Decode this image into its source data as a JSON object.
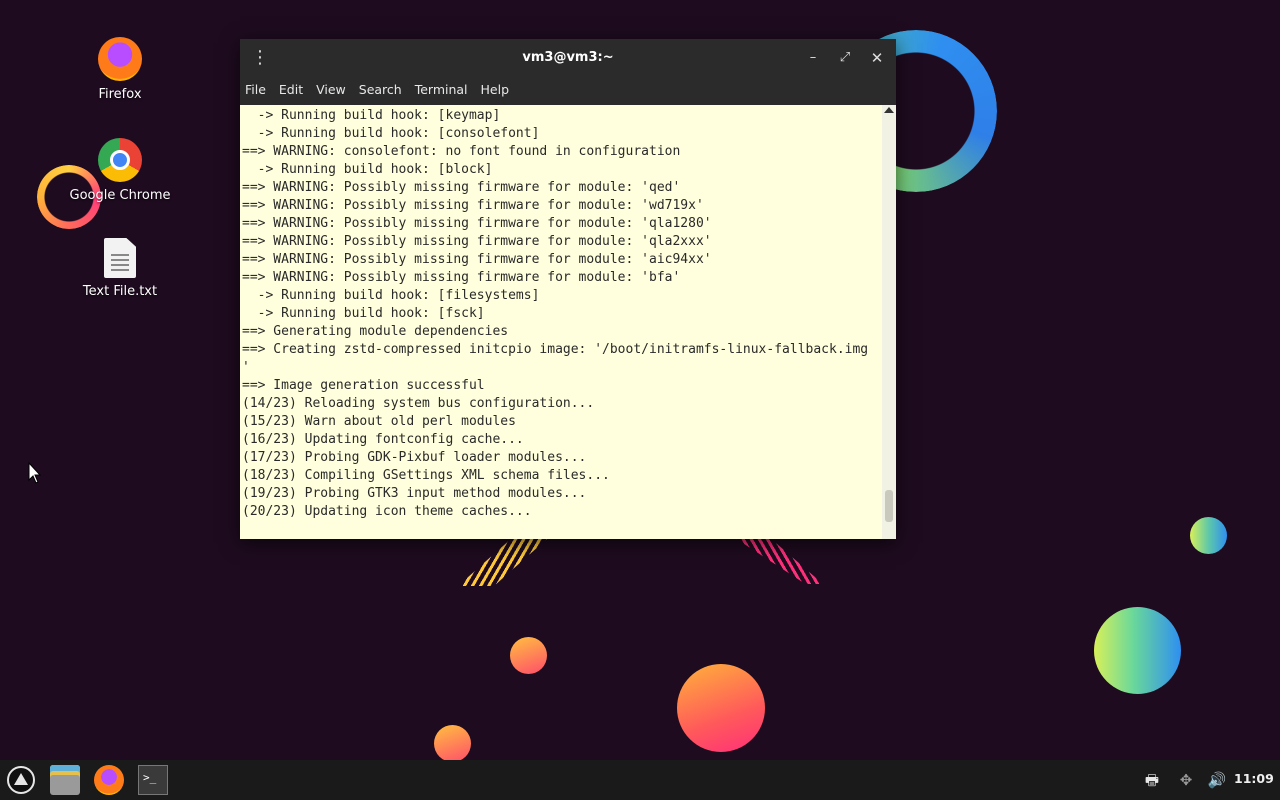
{
  "desktop": {
    "icons": [
      {
        "label": "Firefox",
        "icon": "firefox-icon"
      },
      {
        "label": "Google Chrome",
        "icon": "chrome-icon"
      },
      {
        "label": "Text File.txt",
        "icon": "text-file-icon"
      }
    ]
  },
  "window": {
    "title": "vm3@vm3:~",
    "menu_icon": "⋮",
    "controls": {
      "minimize": "–",
      "maximize": "⤢",
      "close": "✕"
    },
    "menubar": [
      "File",
      "Edit",
      "View",
      "Search",
      "Terminal",
      "Help"
    ],
    "terminal": {
      "background": "#ffffdd",
      "lines": [
        "  -> Running build hook: [keymap]",
        "  -> Running build hook: [consolefont]",
        "==> WARNING: consolefont: no font found in configuration",
        "  -> Running build hook: [block]",
        "==> WARNING: Possibly missing firmware for module: 'qed'",
        "==> WARNING: Possibly missing firmware for module: 'wd719x'",
        "==> WARNING: Possibly missing firmware for module: 'qla1280'",
        "==> WARNING: Possibly missing firmware for module: 'qla2xxx'",
        "==> WARNING: Possibly missing firmware for module: 'aic94xx'",
        "==> WARNING: Possibly missing firmware for module: 'bfa'",
        "  -> Running build hook: [filesystems]",
        "  -> Running build hook: [fsck]",
        "==> Generating module dependencies",
        "==> Creating zstd-compressed initcpio image: '/boot/initramfs-linux-fallback.img",
        "'",
        "==> Image generation successful",
        "(14/23) Reloading system bus configuration...",
        "(15/23) Warn about old perl modules",
        "(16/23) Updating fontconfig cache...",
        "(17/23) Probing GDK-Pixbuf loader modules...",
        "(18/23) Compiling GSettings XML schema files...",
        "(19/23) Probing GTK3 input method modules...",
        "(20/23) Updating icon theme caches..."
      ]
    }
  },
  "taskbar": {
    "items": [
      "start-menu-icon",
      "file-manager-icon",
      "firefox-icon",
      "terminal-icon"
    ],
    "terminal_glyph": ">_",
    "tray": {
      "printer": "🖶",
      "network": "✥",
      "volume": "🔊"
    },
    "clock": "11:09"
  }
}
